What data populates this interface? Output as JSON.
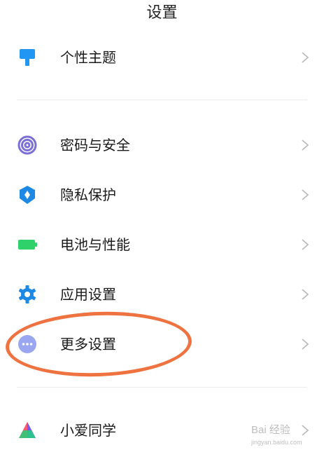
{
  "header": {
    "title": "设置"
  },
  "items": [
    {
      "label": "个性主题",
      "icon": "paint-roller-icon"
    },
    {
      "label": "密码与安全",
      "icon": "fingerprint-icon"
    },
    {
      "label": "隐私保护",
      "icon": "shield-icon"
    },
    {
      "label": "电池与性能",
      "icon": "battery-icon"
    },
    {
      "label": "应用设置",
      "icon": "gear-icon"
    },
    {
      "label": "更多设置",
      "icon": "more-dots-icon"
    },
    {
      "label": "小爱同学",
      "icon": "xiaoai-icon"
    }
  ],
  "annotation": {
    "highlight_color": "#ee7340"
  },
  "watermark": {
    "brand": "Bai 经验",
    "url": "jingyan.baidu.com"
  }
}
